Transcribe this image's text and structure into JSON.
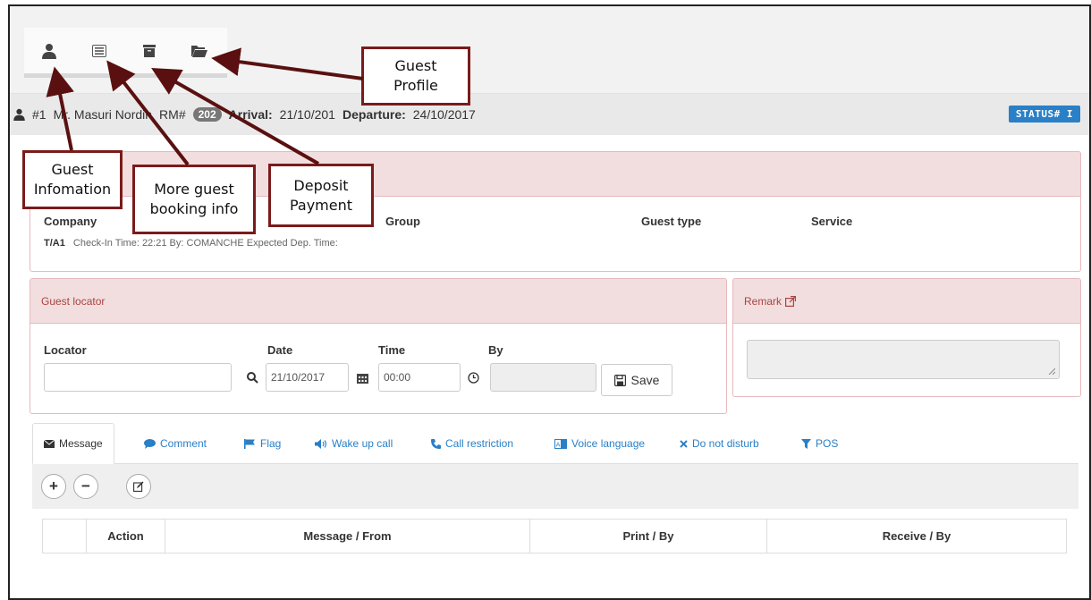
{
  "toolbar": {
    "icons": [
      "user-icon",
      "list-card-icon",
      "archive-box-icon",
      "folder-open-icon"
    ]
  },
  "guest_strip": {
    "number": "#1",
    "name": "Mr. Masuri Nordin",
    "rm_label": "RM#",
    "rm_value": "202",
    "arrival_label": "Arrival:",
    "arrival_value": "21/10/201",
    "departure_label": "Departure:",
    "departure_value": "24/10/2017",
    "status": "STATUS# I"
  },
  "info_panel": {
    "col_company": "Company",
    "col_group": "Group",
    "col_guest_type": "Guest type",
    "col_service": "Service",
    "ta_code": "T/A1",
    "checkin_label": "Check-In Time:",
    "checkin_value": "22:21",
    "by_label": "By:",
    "by_value": "COMANCHE",
    "expected_dep_label": "Expected Dep. Time:"
  },
  "guest_locator": {
    "title": "Guest locator",
    "locator_label": "Locator",
    "date_label": "Date",
    "time_label": "Time",
    "by_label": "By",
    "locator_value": "",
    "date_value": "21/10/2017",
    "time_value": "00:00",
    "by_value": "",
    "save_label": "Save"
  },
  "remark": {
    "title": "Remark"
  },
  "tabs": [
    {
      "label": "Message",
      "icon": "envelope-icon"
    },
    {
      "label": "Comment",
      "icon": "comment-icon"
    },
    {
      "label": "Flag",
      "icon": "flag-icon"
    },
    {
      "label": "Wake up call",
      "icon": "volume-icon"
    },
    {
      "label": "Call restriction",
      "icon": "phone-icon"
    },
    {
      "label": "Voice language",
      "icon": "language-icon"
    },
    {
      "label": "Do not disturb",
      "icon": "x-icon"
    },
    {
      "label": "POS",
      "icon": "filter-icon"
    }
  ],
  "message_table": {
    "columns": [
      "",
      "Action",
      "Message / From",
      "Print / By",
      "Receive / By"
    ]
  },
  "callouts": {
    "guest_profile": [
      "Guest",
      "Profile"
    ],
    "guest_information": [
      "Guest",
      "Infomation"
    ],
    "more_booking": [
      "More guest",
      "booking info"
    ],
    "deposit": [
      "Deposit",
      "Payment"
    ]
  },
  "colors": {
    "panel_header_bg": "#f2dede",
    "panel_header_text": "#a94442",
    "link_blue": "#2a7fc6",
    "callout_border": "#7a1b1b"
  }
}
